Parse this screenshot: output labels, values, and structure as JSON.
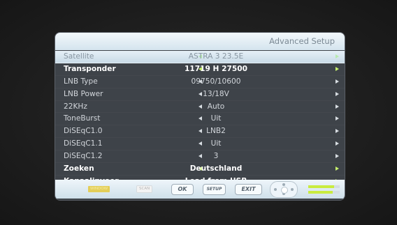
{
  "screen": {
    "title": "Advanced Setup",
    "rows": [
      {
        "label": "Satellite",
        "value": "ASTRA 3 23.5E"
      },
      {
        "label": "Transponder",
        "value": "11719 H 27500"
      },
      {
        "label": "LNB Type",
        "value": "09750/10600"
      },
      {
        "label": "LNB Power",
        "value": "13/18V"
      },
      {
        "label": "22KHz",
        "value": "Auto"
      },
      {
        "label": "ToneBurst",
        "value": "Uit"
      },
      {
        "label": "DiSEqC1.0",
        "value": "LNB2"
      },
      {
        "label": "DiSEqC1.1",
        "value": "Uit"
      },
      {
        "label": "DiSEqC1.2",
        "value": "3"
      },
      {
        "label": "Zoeken",
        "value": "Deutschland"
      },
      {
        "label": "Kanaalinvoer",
        "value": "Load from USB"
      }
    ]
  },
  "footer": {
    "yellow_tag": "WINDOW",
    "white_tag": "SCAN",
    "ok_label": "OK",
    "setup_label": "SETUP",
    "exit_label": "EXIT",
    "signal_strength_level": 0.82,
    "signal_quality_level": 0.78
  },
  "colors": {
    "panel": "#3e4349",
    "highlight": "#d6e6f0",
    "arrow_active": "#c7f06c",
    "signal_bar": "#c9ec3f"
  }
}
